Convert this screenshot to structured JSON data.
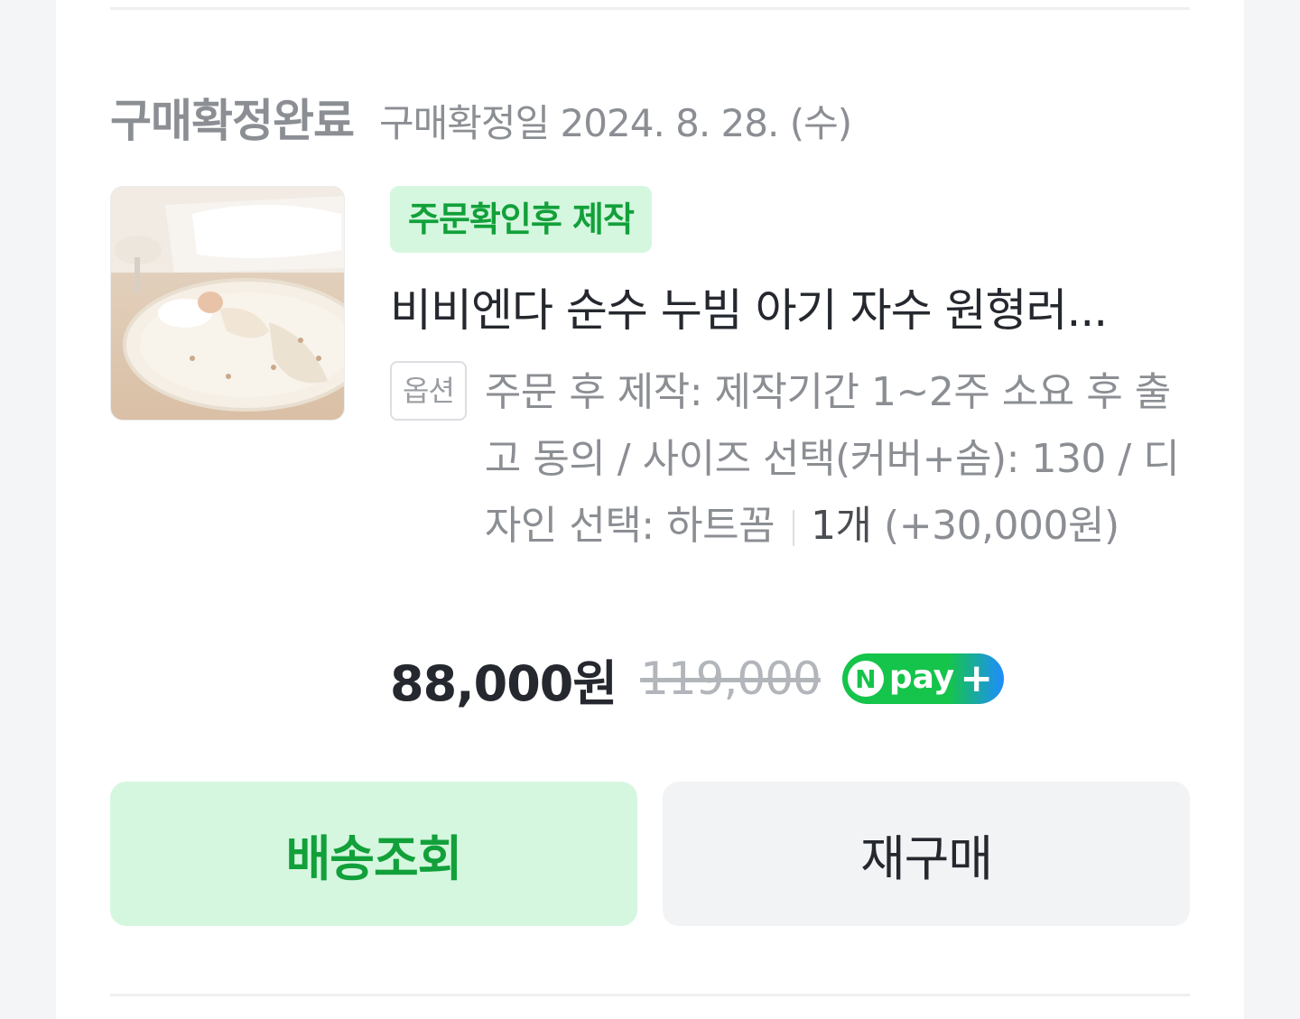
{
  "order": {
    "status": "구매확정완료",
    "confirm_date": "구매확정일 2024. 8. 28. (수)"
  },
  "product": {
    "badge": "주문확인후 제작",
    "name": "비비엔다 순수 누빔 아기 자수 원형러...",
    "option_tag": "옵션",
    "option_text": "주문 후 제작: 제작기간 1~2주 소요 후 출고 동의 / 사이즈 선택(커버+솜): 130 / 디자인 선택: 하트꼼",
    "quantity": "1개",
    "option_price": "(+30,000원)",
    "price": "88,000원",
    "original_price": "119,000",
    "npay_label": "pay",
    "npay_n": "N",
    "npay_plus": "+"
  },
  "actions": {
    "track_label": "배송조회",
    "rebuy_label": "재구매"
  },
  "colors": {
    "accent_green": "#12a03a",
    "badge_bg": "#d5f7df",
    "npay_blue": "#1f8cff"
  },
  "icons": {
    "thumbnail": "product-photo-baby-mat"
  }
}
